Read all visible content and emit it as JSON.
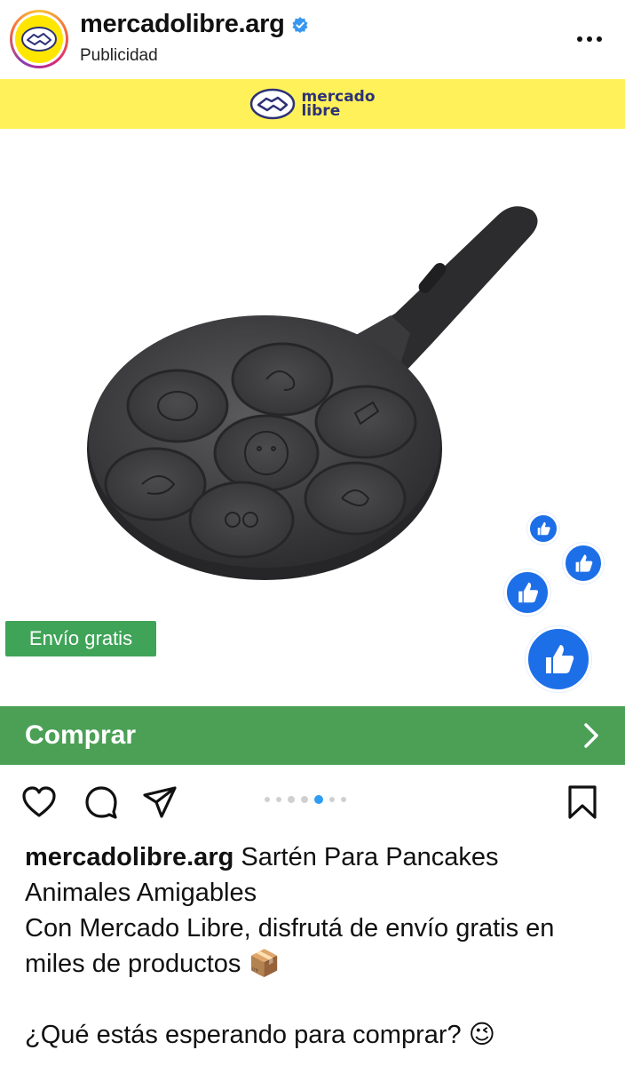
{
  "post_header": {
    "username": "mercadolibre.arg",
    "subtitle": "Publicidad"
  },
  "banner": {
    "logo_line1": "mercado",
    "logo_line2": "libre",
    "background": "#fff159"
  },
  "media": {
    "badge_label": "Envío gratis",
    "carousel_total": 7,
    "carousel_active_index": 4
  },
  "cta": {
    "label": "Comprar",
    "background": "#4ba056"
  },
  "caption": {
    "username": "mercadolibre.arg",
    "title": "Sartén Para Pancakes Animales Amigables",
    "line2": "Con Mercado Libre, disfrutá de envío gratis en miles de productos 📦",
    "line3": "¿Qué estás esperando para comprar? 😉"
  },
  "icons": [
    "handshake-logo-icon",
    "verified-icon",
    "more-options-icon",
    "like-icon",
    "comment-icon",
    "share-icon",
    "save-icon",
    "thumbs-up-icon",
    "chevron-right-icon"
  ]
}
